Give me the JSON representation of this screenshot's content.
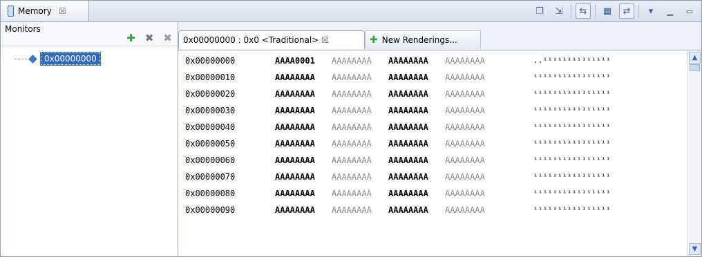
{
  "view": {
    "title": "Memory",
    "close_glyph": "☒"
  },
  "toolbar": {
    "buttons": [
      {
        "name": "new-window-icon",
        "glyph": "❐"
      },
      {
        "name": "link-icon",
        "glyph": "⇲"
      },
      {
        "name": "toggle-memory-monitors-icon",
        "glyph": "⇆"
      },
      {
        "name": "toggle-split-pane-icon",
        "glyph": "▦"
      },
      {
        "name": "switch-pane-icon",
        "glyph": "⇄"
      },
      {
        "name": "view-menu-icon",
        "glyph": "▾"
      }
    ]
  },
  "monitors": {
    "label": "Monitors",
    "item": "0x00000000"
  },
  "renderings": {
    "active_tab": "0x00000000 : 0x0 <Traditional>",
    "new_tab": "New Renderings..."
  },
  "memory": {
    "rows": [
      {
        "addr": "0x00000000",
        "w": [
          "AAAA0001",
          "AAAAAAAA",
          "AAAAAAAA",
          "AAAAAAAA"
        ],
        "ascii": "..¹¹¹¹¹¹¹¹¹¹¹¹¹¹"
      },
      {
        "addr": "0x00000010",
        "w": [
          "AAAAAAAA",
          "AAAAAAAA",
          "AAAAAAAA",
          "AAAAAAAA"
        ],
        "ascii": "¹¹¹¹¹¹¹¹¹¹¹¹¹¹¹¹"
      },
      {
        "addr": "0x00000020",
        "w": [
          "AAAAAAAA",
          "AAAAAAAA",
          "AAAAAAAA",
          "AAAAAAAA"
        ],
        "ascii": "¹¹¹¹¹¹¹¹¹¹¹¹¹¹¹¹"
      },
      {
        "addr": "0x00000030",
        "w": [
          "AAAAAAAA",
          "AAAAAAAA",
          "AAAAAAAA",
          "AAAAAAAA"
        ],
        "ascii": "¹¹¹¹¹¹¹¹¹¹¹¹¹¹¹¹"
      },
      {
        "addr": "0x00000040",
        "w": [
          "AAAAAAAA",
          "AAAAAAAA",
          "AAAAAAAA",
          "AAAAAAAA"
        ],
        "ascii": "¹¹¹¹¹¹¹¹¹¹¹¹¹¹¹¹"
      },
      {
        "addr": "0x00000050",
        "w": [
          "AAAAAAAA",
          "AAAAAAAA",
          "AAAAAAAA",
          "AAAAAAAA"
        ],
        "ascii": "¹¹¹¹¹¹¹¹¹¹¹¹¹¹¹¹"
      },
      {
        "addr": "0x00000060",
        "w": [
          "AAAAAAAA",
          "AAAAAAAA",
          "AAAAAAAA",
          "AAAAAAAA"
        ],
        "ascii": "¹¹¹¹¹¹¹¹¹¹¹¹¹¹¹¹"
      },
      {
        "addr": "0x00000070",
        "w": [
          "AAAAAAAA",
          "AAAAAAAA",
          "AAAAAAAA",
          "AAAAAAAA"
        ],
        "ascii": "¹¹¹¹¹¹¹¹¹¹¹¹¹¹¹¹"
      },
      {
        "addr": "0x00000080",
        "w": [
          "AAAAAAAA",
          "AAAAAAAA",
          "AAAAAAAA",
          "AAAAAAAA"
        ],
        "ascii": "¹¹¹¹¹¹¹¹¹¹¹¹¹¹¹¹"
      },
      {
        "addr": "0x00000090",
        "w": [
          "AAAAAAAA",
          "AAAAAAAA",
          "AAAAAAAA",
          "AAAAAAAA"
        ],
        "ascii": "¹¹¹¹¹¹¹¹¹¹¹¹¹¹¹¹"
      }
    ]
  }
}
